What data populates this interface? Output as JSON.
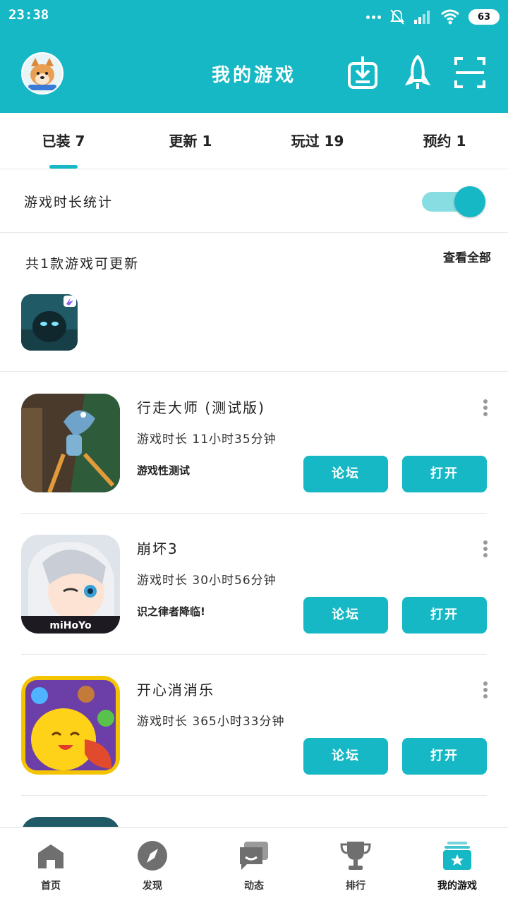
{
  "status_bar": {
    "time": "23:38",
    "battery": "63"
  },
  "header": {
    "title": "我的游戏"
  },
  "tabs": [
    {
      "label": "已装 7",
      "active": true
    },
    {
      "label": "更新 1",
      "active": false
    },
    {
      "label": "玩过 19",
      "active": false
    },
    {
      "label": "预约 1",
      "active": false
    }
  ],
  "playtime_stats": {
    "label": "游戏时长统计",
    "enabled": true
  },
  "updates": {
    "summary": "共1款游戏可更新",
    "view_all": "查看全部"
  },
  "games": [
    {
      "name": "行走大师 (测试版)",
      "playtime": "游戏时长 11小时35分钟",
      "tag": "游戏性测试",
      "forum_label": "论坛",
      "open_label": "打开"
    },
    {
      "name": "崩坏3",
      "playtime": "游戏时长 30小时56分钟",
      "tag": "识之律者降临!",
      "forum_label": "论坛",
      "open_label": "打开"
    },
    {
      "name": "开心消消乐",
      "playtime": "游戏时长 365小时33分钟",
      "tag": "",
      "forum_label": "论坛",
      "open_label": "打开"
    }
  ],
  "bottom_nav": [
    {
      "label": "首页",
      "icon": "home-icon"
    },
    {
      "label": "发现",
      "icon": "compass-icon"
    },
    {
      "label": "动态",
      "icon": "chat-icon"
    },
    {
      "label": "排行",
      "icon": "trophy-icon"
    },
    {
      "label": "我的游戏",
      "icon": "my-games-icon",
      "active": true
    }
  ],
  "colors": {
    "accent": "#15b8c4",
    "accent_light": "#88dde3"
  }
}
